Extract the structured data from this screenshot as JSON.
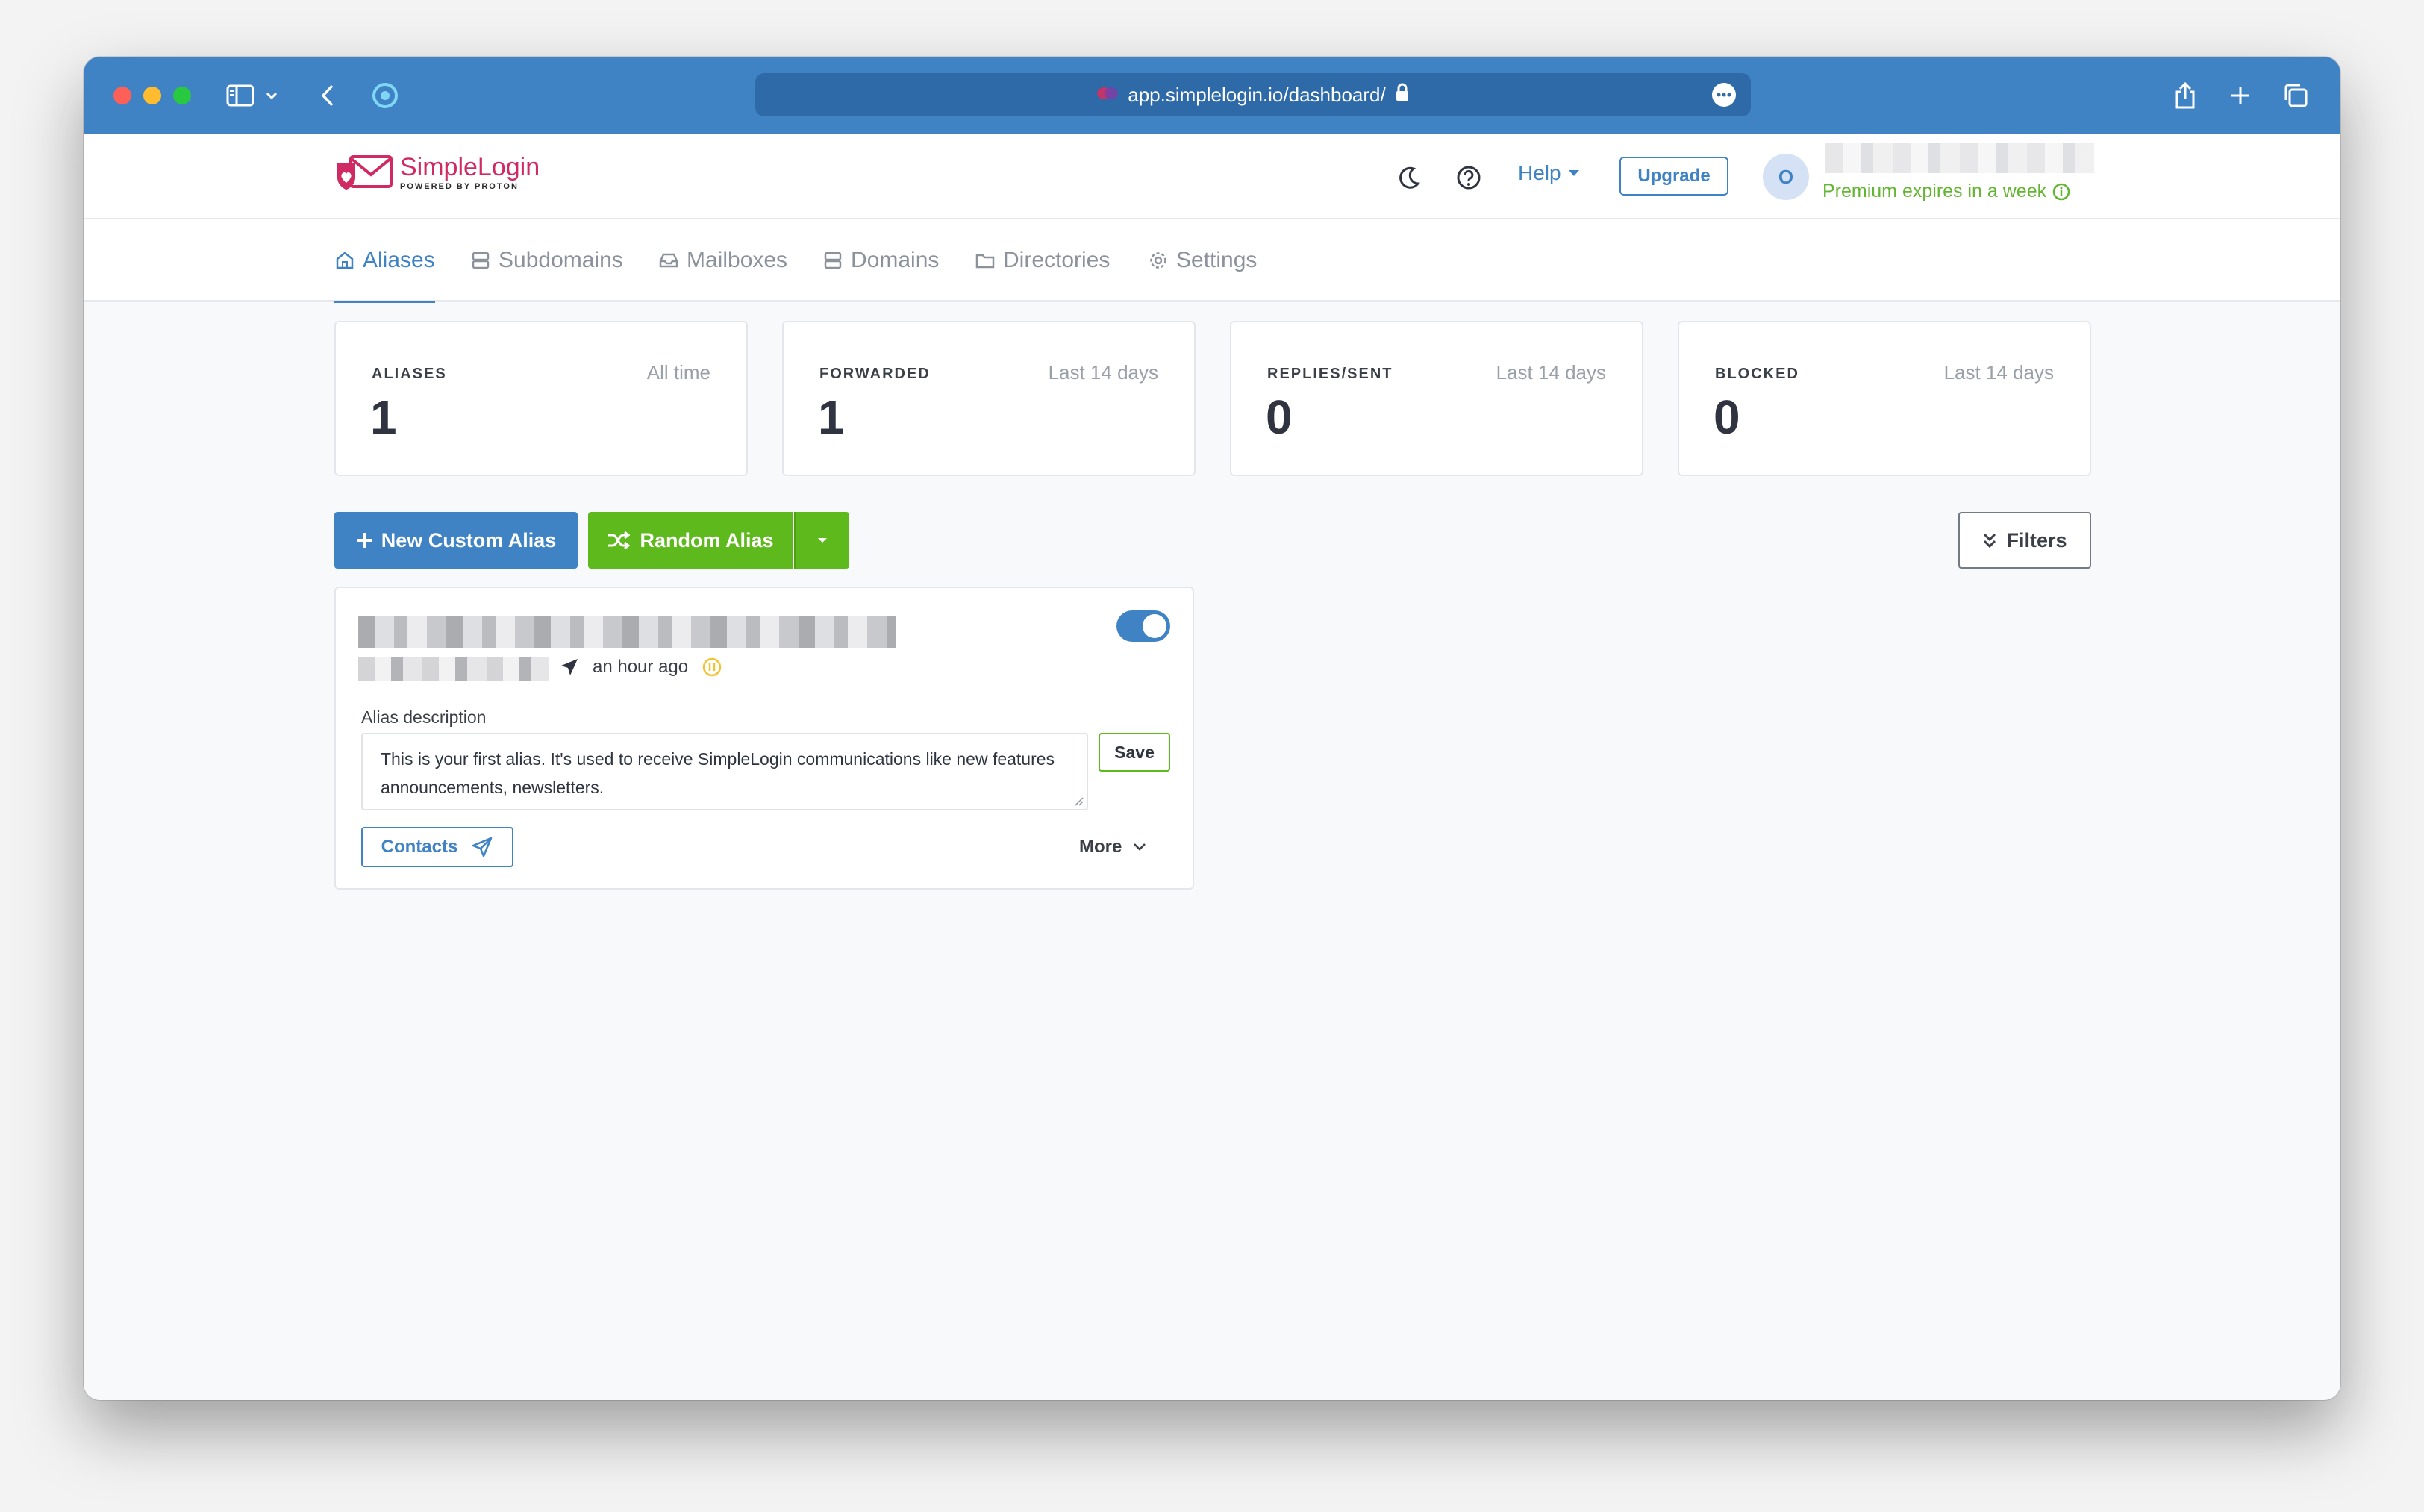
{
  "browser": {
    "url": "app.simplelogin.io/dashboard/",
    "icons": [
      "sidebar-icon",
      "chevron-down-icon",
      "back-icon",
      "privacy-report-icon",
      "lock-icon",
      "more-icon",
      "share-icon",
      "new-tab-icon",
      "tabs-overview-icon"
    ]
  },
  "header": {
    "brand": "SimpleLogin",
    "brand_sub": "POWERED BY PROTON",
    "help_label": "Help",
    "upgrade_label": "Upgrade",
    "avatar_initial": "O",
    "premium_text": "Premium expires in a week",
    "colors": {
      "brand": "#cf2a64",
      "accent": "#3f83c5",
      "success": "#5eb91d"
    }
  },
  "nav": {
    "tabs": [
      {
        "label": "Aliases",
        "icon": "home-icon",
        "active": true
      },
      {
        "label": "Subdomains",
        "icon": "server-icon"
      },
      {
        "label": "Mailboxes",
        "icon": "inbox-icon"
      },
      {
        "label": "Domains",
        "icon": "server-icon"
      },
      {
        "label": "Directories",
        "icon": "folder-icon"
      },
      {
        "label": "Settings",
        "icon": "gear-icon"
      }
    ]
  },
  "stats": [
    {
      "label": "ALIASES",
      "period": "All time",
      "value": "1"
    },
    {
      "label": "FORWARDED",
      "period": "Last 14 days",
      "value": "1"
    },
    {
      "label": "REPLIES/SENT",
      "period": "Last 14 days",
      "value": "0"
    },
    {
      "label": "BLOCKED",
      "period": "Last 14 days",
      "value": "0"
    }
  ],
  "actions": {
    "new_custom_alias": "New Custom Alias",
    "random_alias": "Random Alias",
    "filters": "Filters"
  },
  "alias": {
    "time_ago": "an hour ago",
    "enabled": true,
    "description_label": "Alias description",
    "description": "This is your first alias. It's used to receive SimpleLogin communications like new features announcements, newsletters.",
    "save_label": "Save",
    "contacts_label": "Contacts",
    "more_label": "More"
  }
}
